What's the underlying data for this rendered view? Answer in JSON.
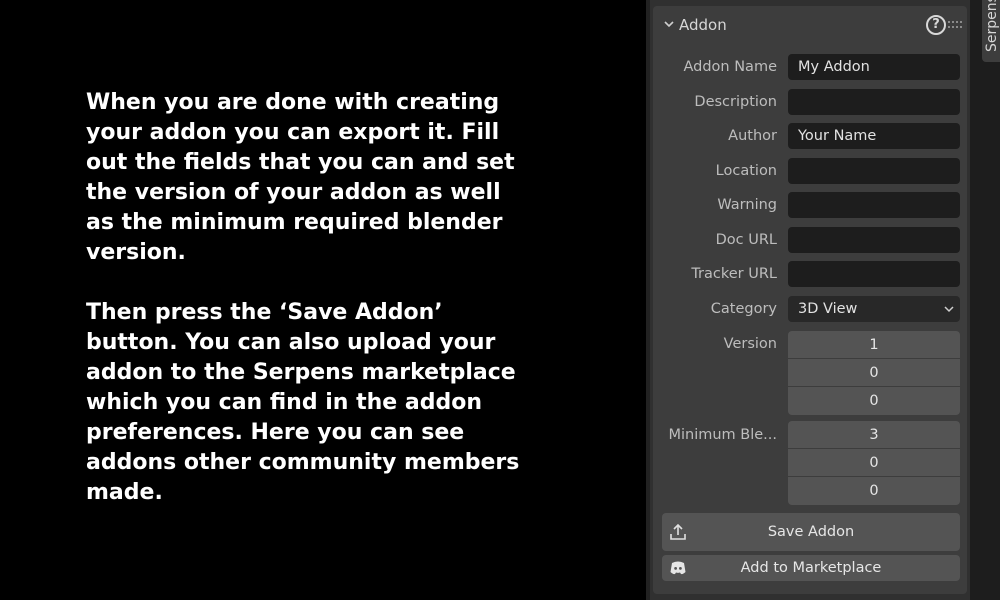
{
  "tutorial": {
    "paragraph1": "When you are done with creating your addon you can export it. Fill out the fields that you can and set the version of your addon as well as the minimum required blender version.",
    "paragraph2": "Then press the ‘Save Addon’ button. You can also upload your addon to the Serpens marketplace which you can find in the addon preferences. Here you can see addons other community members made."
  },
  "panel": {
    "title": "Addon",
    "help_glyph": "?",
    "fields": {
      "addon_name": {
        "label": "Addon Name",
        "value": "My Addon"
      },
      "description": {
        "label": "Description",
        "value": ""
      },
      "author": {
        "label": "Author",
        "value": "Your Name"
      },
      "location": {
        "label": "Location",
        "value": ""
      },
      "warning": {
        "label": "Warning",
        "value": ""
      },
      "doc_url": {
        "label": "Doc URL",
        "value": ""
      },
      "tracker_url": {
        "label": "Tracker URL",
        "value": ""
      }
    },
    "category": {
      "label": "Category",
      "value": "3D View"
    },
    "version": {
      "label": "Version",
      "values": [
        "1",
        "0",
        "0"
      ]
    },
    "min_blender": {
      "label": "Minimum Ble...",
      "values": [
        "3",
        "0",
        "0"
      ]
    },
    "save_button": {
      "label": "Save Addon",
      "icon": "export-icon"
    },
    "marketplace_button": {
      "label": "Add to Marketplace",
      "icon": "discord-icon"
    }
  },
  "sidebar": {
    "tab_label": "Serpens"
  },
  "colors": {
    "background": "#000000",
    "panel_bg": "#3d3d3d",
    "field_bg": "#1d1d1d",
    "button_bg": "#545454",
    "text": "#ffffff"
  }
}
